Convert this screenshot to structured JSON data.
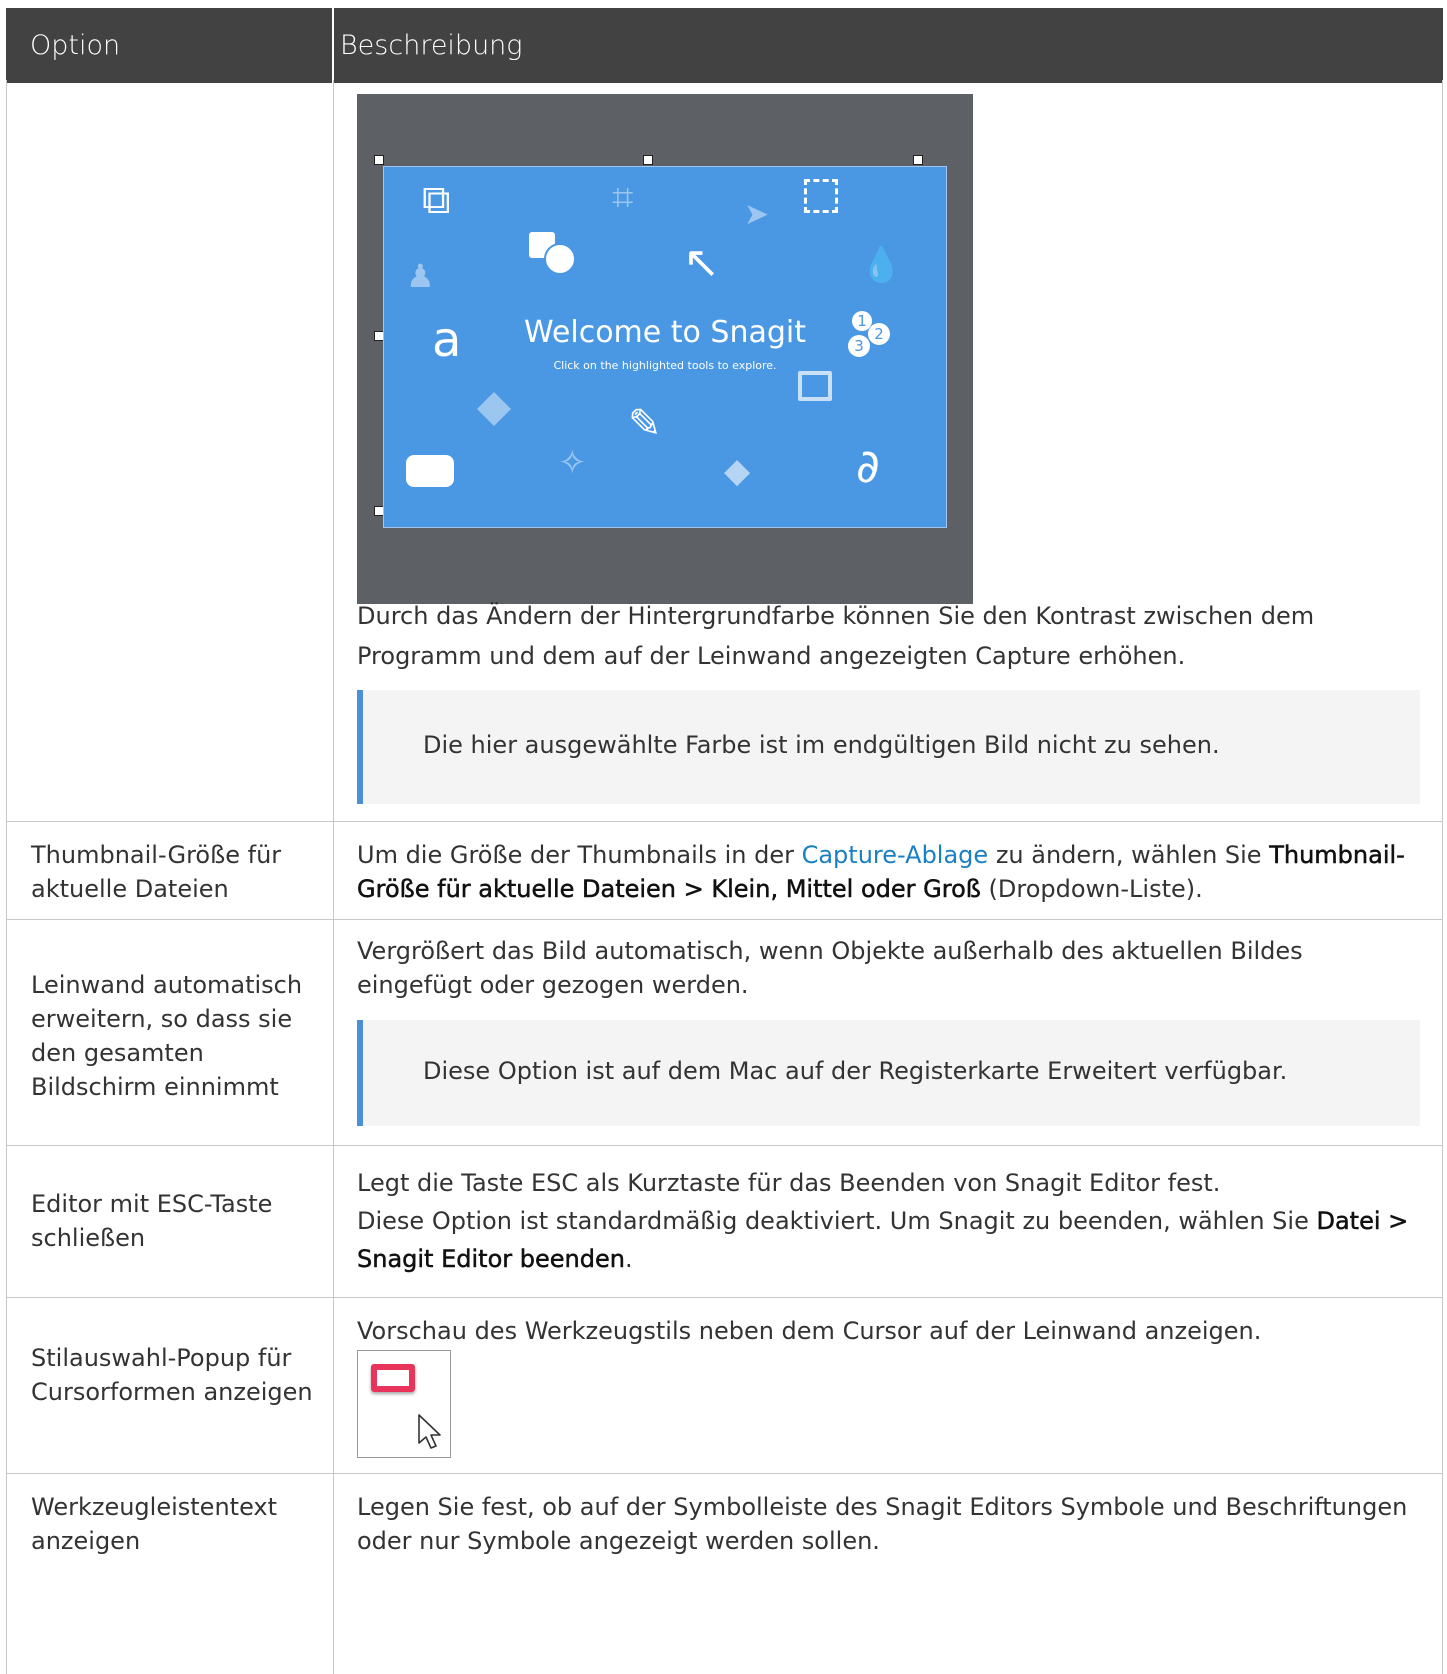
{
  "header": {
    "option": "Option",
    "description": "Beschreibung"
  },
  "screenshot": {
    "title": "Welcome to Snagit",
    "subtitle": "Click on the highlighted tools to explore."
  },
  "rows": [
    {
      "option": "",
      "desc_text": "Durch das Ändern der Hintergrundfarbe können Sie den Kontrast zwischen dem Programm und dem auf der Leinwand angezeigten Capture erhöhen.",
      "note": "Die hier ausgewählte Farbe ist im endgültigen Bild nicht zu sehen."
    },
    {
      "option": "Thumbnail-Größe für aktuelle Dateien",
      "desc_a": "Um die Größe der Thumbnails in der ",
      "desc_link": "Capture-Ablage",
      "desc_b": " zu ändern, wählen Sie ",
      "desc_bold": "Thumbnail-Größe für aktuelle Dateien > Klein, Mittel oder Groß",
      "desc_c": " (Dropdown-Liste)."
    },
    {
      "option": "Leinwand automatisch erweitern, so dass sie den gesamten Bildschirm einnimmt",
      "desc_text": "Vergrößert das Bild automatisch, wenn Objekte außerhalb des aktuellen Bildes eingefügt oder gezogen werden.",
      "note": "Diese Option ist auf dem Mac auf der Registerkarte Erweitert verfügbar."
    },
    {
      "option": "Editor mit ESC-Taste schließen",
      "desc_line1": "Legt die Taste ESC als Kurztaste für das Beenden von Snagit Editor fest.",
      "desc_line2": "Diese Option ist standardmäßig deaktiviert. Um Snagit zu beenden, wählen Sie ",
      "desc_bold": "Datei > Snagit Editor beenden",
      "desc_end": "."
    },
    {
      "option": "Stilauswahl-Popup für Cursorformen anzeigen",
      "desc_text": "Vorschau des Werkzeugstils neben dem Cursor auf der Leinwand anzeigen."
    },
    {
      "option": "Werkzeugleistentext anzeigen",
      "desc_text": "Legen Sie fest, ob auf der Symbolleiste des Snagit Editors Symbole und Beschriftungen oder nur Symbole angezeigt werden sollen."
    }
  ]
}
